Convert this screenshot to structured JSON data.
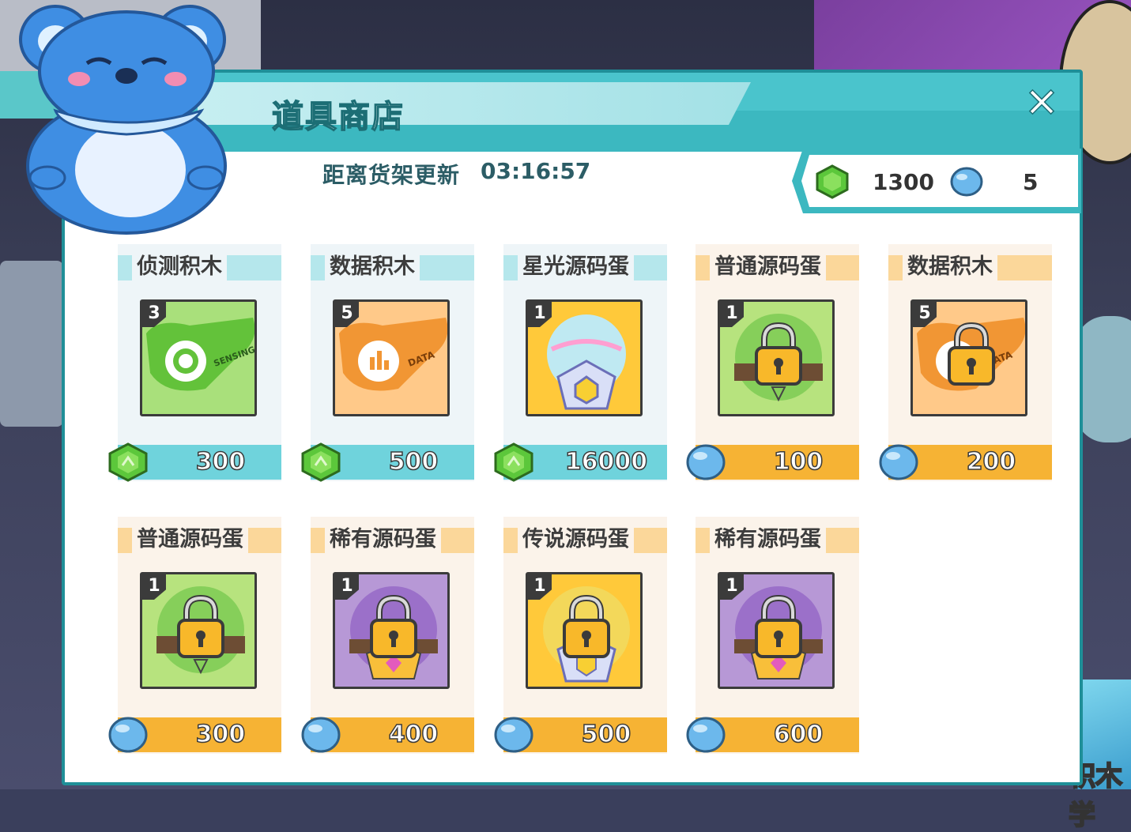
{
  "shop": {
    "title": "道具商店",
    "close_icon": "close-icon",
    "timer_label": "距离货架更新",
    "timer_value": "03:16:57",
    "cart_icon": "cart-icon"
  },
  "currency": {
    "gem_icon": "green-gem-icon",
    "gem_amount": "1300",
    "orb_icon": "blue-orb-icon",
    "orb_amount": "5"
  },
  "colors": {
    "accent_teal": "#3cb8c0",
    "price_teal": "#6fd3dc",
    "price_orange": "#f6b334"
  },
  "items": [
    {
      "name": "侦测积木",
      "badge": "3",
      "price": "300",
      "currency": "gem",
      "locked": false,
      "image": "sensing-block"
    },
    {
      "name": "数据积木",
      "badge": "5",
      "price": "500",
      "currency": "gem",
      "locked": false,
      "image": "data-block"
    },
    {
      "name": "星光源码蛋",
      "badge": "1",
      "price": "16000",
      "currency": "gem",
      "locked": false,
      "image": "starlight-egg"
    },
    {
      "name": "普通源码蛋",
      "badge": "1",
      "price": "100",
      "currency": "orb",
      "locked": true,
      "image": "common-egg"
    },
    {
      "name": "数据积木",
      "badge": "5",
      "price": "200",
      "currency": "orb",
      "locked": true,
      "image": "data-block"
    },
    {
      "name": "普通源码蛋",
      "badge": "1",
      "price": "300",
      "currency": "orb",
      "locked": true,
      "image": "common-egg"
    },
    {
      "name": "稀有源码蛋",
      "badge": "1",
      "price": "400",
      "currency": "orb",
      "locked": true,
      "image": "rare-egg"
    },
    {
      "name": "传说源码蛋",
      "badge": "1",
      "price": "500",
      "currency": "orb",
      "locked": true,
      "image": "legend-egg"
    },
    {
      "name": "稀有源码蛋",
      "badge": "1",
      "price": "600",
      "currency": "orb",
      "locked": true,
      "image": "rare-egg"
    }
  ],
  "image_text": {
    "sensing_label": "SENSING",
    "data_label": "DATA"
  },
  "background": {
    "block_text": "积木学"
  }
}
